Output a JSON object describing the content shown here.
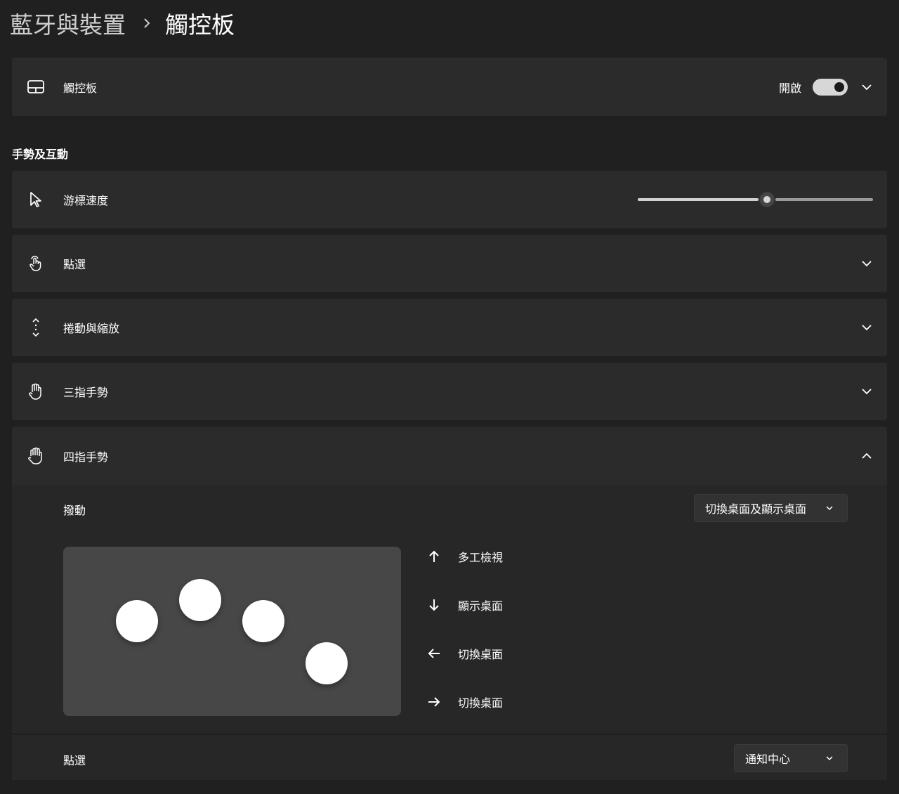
{
  "breadcrumb": {
    "parent": "藍牙與裝置",
    "current": "觸控板"
  },
  "touchpad_card": {
    "label": "觸控板",
    "toggle_label": "開啟",
    "toggle_on": true,
    "icon": "touchpad-icon"
  },
  "section_gestures": {
    "title": "手勢及互動"
  },
  "cursor_speed": {
    "label": "游標速度",
    "icon": "cursor-icon",
    "value_fraction": 0.55
  },
  "tap_card": {
    "label": "點選",
    "icon": "tap-hand-icon"
  },
  "scroll_zoom_card": {
    "label": "捲動與縮放",
    "icon": "scroll-icon"
  },
  "three_finger_card": {
    "label": "三指手勢",
    "icon": "three-finger-hand-icon"
  },
  "four_finger_card": {
    "label": "四指手勢",
    "icon": "four-finger-hand-icon",
    "expanded": true,
    "swipe_label": "撥動",
    "swipe_value": "切換桌面及顯示桌面",
    "gestures": [
      {
        "direction": "up",
        "icon": "arrow-up-icon",
        "text": "多工檢視"
      },
      {
        "direction": "down",
        "icon": "arrow-down-icon",
        "text": "顯示桌面"
      },
      {
        "direction": "left",
        "icon": "arrow-left-icon",
        "text": "切換桌面"
      },
      {
        "direction": "right",
        "icon": "arrow-right-icon",
        "text": "切換桌面"
      }
    ],
    "tap_label": "點選",
    "tap_value": "通知中心"
  },
  "colors": {
    "background": "#202020",
    "card": "#2b2b2b",
    "touchpad_preview": "#474747"
  }
}
